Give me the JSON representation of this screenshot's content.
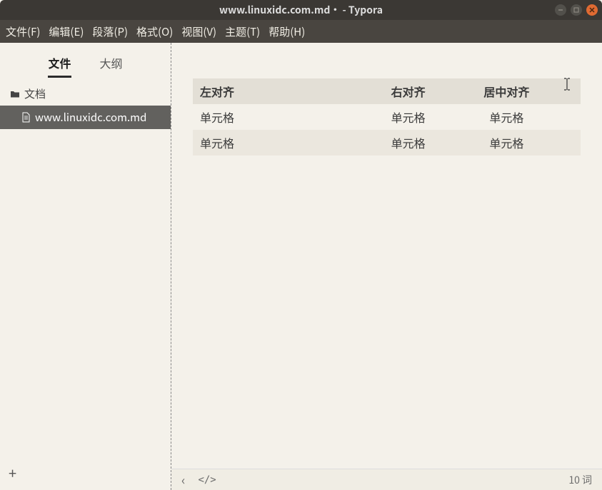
{
  "window": {
    "title": "www.linuxidc.com.md• - Typora"
  },
  "menu": {
    "file": "文件(F)",
    "edit": "编辑(E)",
    "paragraph": "段落(P)",
    "format": "格式(O)",
    "view": "视图(V)",
    "theme": "主题(T)",
    "help": "帮助(H)"
  },
  "sidebar": {
    "tabs": {
      "files": "文件",
      "outline": "大纲"
    },
    "folder": "文档",
    "file": "www.linuxidc.com.md",
    "new_symbol": "+"
  },
  "table": {
    "headers": {
      "left": "左对齐",
      "right": "右对齐",
      "center": "居中对齐"
    },
    "rows": [
      {
        "left": "单元格",
        "right": "单元格",
        "center": "单元格"
      },
      {
        "left": "单元格",
        "right": "单元格",
        "center": "单元格"
      }
    ]
  },
  "status": {
    "back": "‹",
    "source": "</>",
    "wordcount": "10 词"
  }
}
